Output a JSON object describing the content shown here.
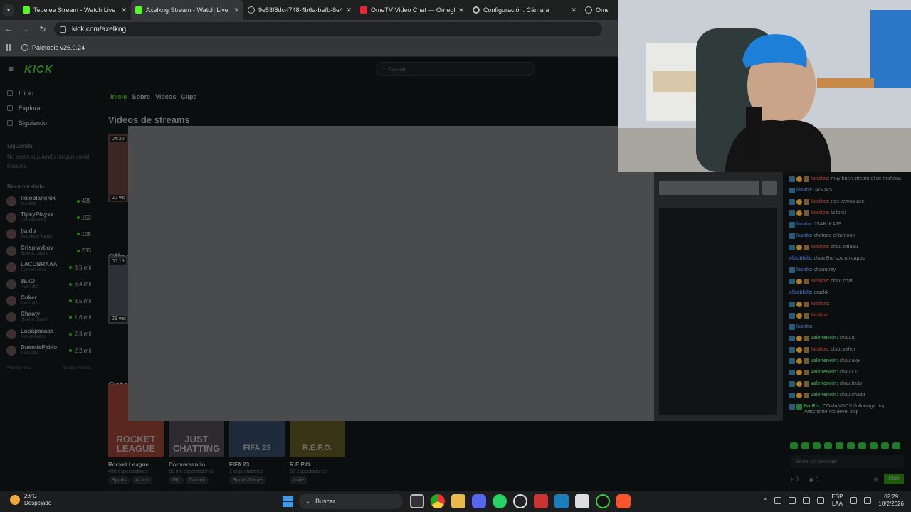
{
  "browser": {
    "tabs": [
      {
        "label": "Tebelee Stream - Watch Live on",
        "icon": "kick-icon",
        "active": false
      },
      {
        "label": "Axelkng Stream - Watch Live on",
        "icon": "kick-icon",
        "active": true
      },
      {
        "label": "9e53f8dc-f748-4b6a-befb-8e4",
        "icon": "globe-icon",
        "active": false
      },
      {
        "label": "OmeTV Video Chat — Omegle",
        "icon": "ometv-icon",
        "active": false
      },
      {
        "label": "Configuración: Cámara",
        "icon": "gear-icon",
        "active": false
      },
      {
        "label": "Ome TV",
        "icon": "globe-icon",
        "active": false
      }
    ],
    "close_glyph": "✕",
    "url": "kick.com/axelkng",
    "bookmark": "Paletools v26.0.24"
  },
  "kick": {
    "logo": "KICK",
    "search_placeholder": "Buscar",
    "nav": [
      "Inicio",
      "Explorar",
      "Siguiendo"
    ],
    "following_head": "Siguiendo",
    "following_note": "No estás siguiendo ningún canal todavía",
    "recommended_head": "Recomendado",
    "recommended": [
      {
        "name": "nicoblanchix",
        "cat": "Eurotrip",
        "count": "435"
      },
      {
        "name": "TipsyPlayss",
        "cat": "Conversando",
        "count": "153"
      },
      {
        "name": "baldu",
        "cat": "Teamfight Tactics",
        "count": "105"
      },
      {
        "name": "Crisplayboy",
        "cat": "Slots & Casino",
        "count": "233"
      },
      {
        "name": "LACOBRAAA",
        "cat": "Conversando",
        "count": "8,5 mil"
      },
      {
        "name": "zEkO",
        "cat": "Hunsoft2",
        "count": "8,4 mil"
      },
      {
        "name": "Coker",
        "cat": "Hunsoft2",
        "count": "3,5 mil"
      },
      {
        "name": "Chanty",
        "cat": "Slots & Casino",
        "count": "1,6 mil"
      },
      {
        "name": "LaSapaaaaa",
        "cat": "Conversando",
        "count": "2,3 mil"
      },
      {
        "name": "DuendePablo",
        "cat": "Hunsoft2",
        "count": "2,2 mil"
      }
    ],
    "show_more": "Mostrar más",
    "show_less": "Mostrar Menos",
    "channel_tabs": [
      "Inicio",
      "Sobre",
      "Videos",
      "Clips"
    ],
    "sec_videos": "Videos de streams",
    "sec_clips": "Clips",
    "sec_cats": "Categ",
    "video_badge": "04:22:",
    "video_views": "20 vis",
    "clip_badge": "00:15",
    "clip_views": "29 visi",
    "categories": [
      {
        "art": "ROCKET LEAGUE",
        "name": "Rocket League",
        "views": "458 espectadores",
        "tags": [
          "Sports",
          "Action"
        ],
        "color": "#5a2620"
      },
      {
        "art": "JUST CHATTING",
        "name": "Conversando",
        "views": "81 mil espectadores",
        "tags": [
          "IRL",
          "Casual"
        ],
        "color": "#2c2a2e"
      },
      {
        "art": "FIFA 23",
        "name": "FIFA 23",
        "views": "1 espectadores",
        "tags": [
          "Sports Game"
        ],
        "color": "#1f2a3a"
      },
      {
        "art": "R.E.P.O.",
        "name": "R.E.P.O.",
        "views": "69 espectadores",
        "tags": [
          "Indie"
        ],
        "color": "#3a3416"
      }
    ]
  },
  "chat": {
    "messages": [
      {
        "user": "luisitoz",
        "cls": "u-red",
        "badges": "abc",
        "text": "muy buen stream el de mañana"
      },
      {
        "user": "lasxtu",
        "cls": "u-blue",
        "badges": "a",
        "text": "JASJAS"
      },
      {
        "user": "luisitoz",
        "cls": "u-red",
        "badges": "abc",
        "text": "nos vemos axel"
      },
      {
        "user": "luisitoz",
        "cls": "u-red",
        "badges": "abc",
        "text": "la torsi"
      },
      {
        "user": "lasxtu",
        "cls": "u-blue",
        "badges": "a",
        "text": "JSAKJKAJS"
      },
      {
        "user": "lasxtu",
        "cls": "u-blue",
        "badges": "a",
        "text": "chetooo el tamoon"
      },
      {
        "user": "luisitoz",
        "cls": "u-red",
        "badges": "abc",
        "text": "chau calaau"
      },
      {
        "user": "elbobbilz",
        "cls": "u-blue",
        "badges": "",
        "text": "chau Bro sos un capos"
      },
      {
        "user": "lasxtu",
        "cls": "u-blue",
        "badges": "a",
        "text": "chauu rey"
      },
      {
        "user": "luisitoz",
        "cls": "u-red",
        "badges": "abc",
        "text": "chau chat"
      },
      {
        "user": "elbobbilz",
        "cls": "u-blue",
        "badges": "",
        "text": "crackk"
      },
      {
        "user": "luisitoz",
        "cls": "u-red",
        "badges": "abc",
        "text": ""
      },
      {
        "user": "luisitoz",
        "cls": "u-red",
        "badges": "abc",
        "text": ""
      },
      {
        "user": "lasxtu",
        "cls": "u-blue",
        "badges": "a",
        "text": ""
      },
      {
        "user": "valenenein",
        "cls": "u-green",
        "badges": "abc",
        "text": "chauuu"
      },
      {
        "user": "luisitoz",
        "cls": "u-red",
        "badges": "abc",
        "text": "chau valen"
      },
      {
        "user": "valenenein",
        "cls": "u-green",
        "badges": "abc",
        "text": "chau axel"
      },
      {
        "user": "valenenein",
        "cls": "u-green",
        "badges": "abc",
        "text": "chauu lu"
      },
      {
        "user": "valenenein",
        "cls": "u-green",
        "badges": "abc",
        "text": "chau lauty"
      },
      {
        "user": "valenenein",
        "cls": "u-green",
        "badges": "abc",
        "text": "chau chaatt"
      },
      {
        "user": "BotRix",
        "cls": "u-green",
        "badges": "ag",
        "text": "COMANDOS !followage !top !watchtime !xp !level !clip"
      }
    ],
    "input_placeholder": "Enviar un mensaje",
    "count_a": "0",
    "count_b": "0",
    "send": "Chat"
  },
  "taskbar": {
    "temp": "23°C",
    "weather": "Despejado",
    "search": "Buscar",
    "lang_top": "ESP",
    "lang_bottom": "LAA",
    "time": "02:29",
    "date": "10/2/2026"
  }
}
